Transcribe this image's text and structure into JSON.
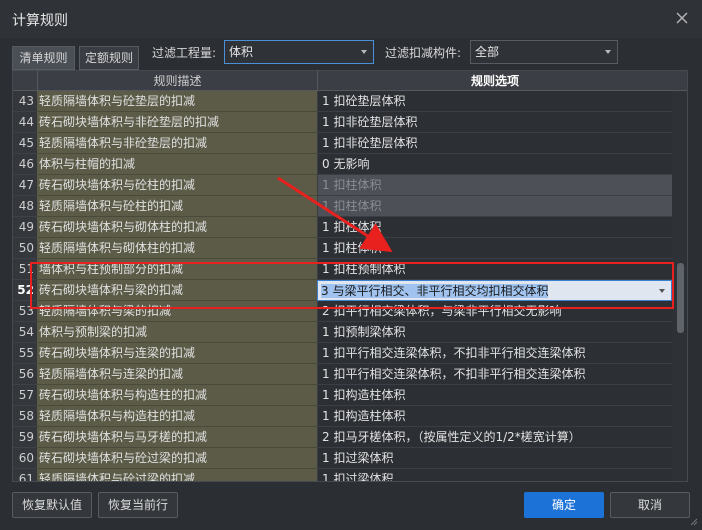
{
  "window": {
    "title": "计算规则"
  },
  "tabs": [
    {
      "label": "清单规则"
    },
    {
      "label": "定额规则"
    }
  ],
  "filters": {
    "quantity_label": "过滤工程量:",
    "quantity_value": "体积",
    "deduct_label": "过滤扣减构件:",
    "deduct_value": "全部"
  },
  "table": {
    "headers": {
      "description": "规则描述",
      "option": "规则选项"
    },
    "rows": [
      {
        "num": "43",
        "desc": "轻质隔墙体积与砼垫层的扣减",
        "opt": "1  扣砼垫层体积",
        "state": "normal"
      },
      {
        "num": "44",
        "desc": "砖石砌块墙体积与非砼垫层的扣减",
        "opt": "1  扣非砼垫层体积",
        "state": "normal"
      },
      {
        "num": "45",
        "desc": "轻质隔墙体积与非砼垫层的扣减",
        "opt": "1  扣非砼垫层体积",
        "state": "normal"
      },
      {
        "num": "46",
        "desc": "体积与柱帽的扣减",
        "opt": "0  无影响",
        "state": "normal"
      },
      {
        "num": "47",
        "desc": "砖石砌块墙体积与砼柱的扣减",
        "opt": "1  扣柱体积",
        "state": "disabled"
      },
      {
        "num": "48",
        "desc": "轻质隔墙体积与砼柱的扣减",
        "opt": "1  扣柱体积",
        "state": "disabled"
      },
      {
        "num": "49",
        "desc": "砖石砌块墙体积与砌体柱的扣减",
        "opt": "1  扣柱体积",
        "state": "normal"
      },
      {
        "num": "50",
        "desc": "轻质隔墙体积与砌体柱的扣减",
        "opt": "1  扣柱体积",
        "state": "normal"
      },
      {
        "num": "51",
        "desc": "墙体积与柱预制部分的扣减",
        "opt": "1  扣柱预制体积",
        "state": "normal"
      },
      {
        "num": "52",
        "desc": "砖石砌块墙体积与梁的扣减",
        "opt": "3  与梁平行相交、非平行相交均扣相交体积",
        "state": "editing"
      },
      {
        "num": "53",
        "desc": "轻质隔墙体积与梁的扣减",
        "opt": "2  扣平行相交梁体积，与梁非平行相交无影响",
        "state": "normal"
      },
      {
        "num": "54",
        "desc": "体积与预制梁的扣减",
        "opt": "1  扣预制梁体积",
        "state": "normal"
      },
      {
        "num": "55",
        "desc": "砖石砌块墙体积与连梁的扣减",
        "opt": "1  扣平行相交连梁体积，不扣非平行相交连梁体积",
        "state": "normal"
      },
      {
        "num": "56",
        "desc": "轻质隔墙体积与连梁的扣减",
        "opt": "1  扣平行相交连梁体积，不扣非平行相交连梁体积",
        "state": "normal"
      },
      {
        "num": "57",
        "desc": "砖石砌块墙体积与构造柱的扣减",
        "opt": "1  扣构造柱体积",
        "state": "normal"
      },
      {
        "num": "58",
        "desc": "轻质隔墙体积与构造柱的扣减",
        "opt": "1  扣构造柱体积",
        "state": "normal"
      },
      {
        "num": "59",
        "desc": "砖石砌块墙体积与马牙槎的扣减",
        "opt": "2  扣马牙槎体积，（按属性定义的1/2*槎宽计算）",
        "state": "normal"
      },
      {
        "num": "60",
        "desc": "砖石砌块墙体积与砼过梁的扣减",
        "opt": "1  扣过梁体积",
        "state": "normal"
      },
      {
        "num": "61",
        "desc": "轻质隔墙体积与砼过梁的扣减",
        "opt": "1  扣过梁体积",
        "state": "normal"
      }
    ]
  },
  "buttons": {
    "restore_default": "恢复默认值",
    "restore_row": "恢复当前行",
    "ok": "确定",
    "cancel": "取消"
  },
  "annotation_colors": {
    "highlight": "#e8201e"
  }
}
